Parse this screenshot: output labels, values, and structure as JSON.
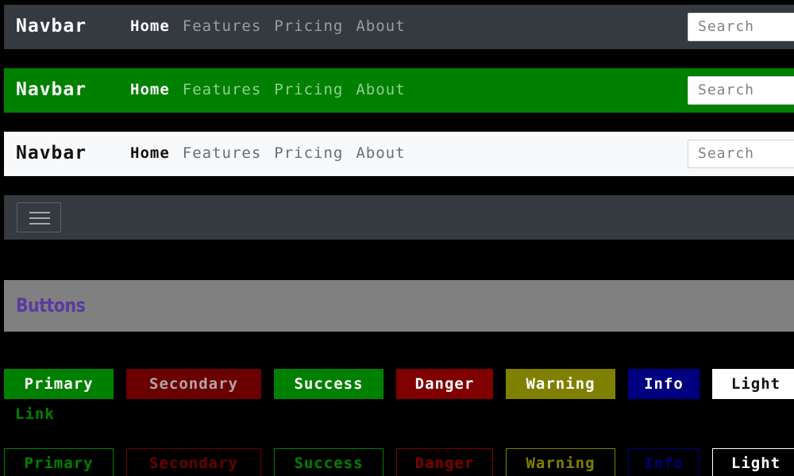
{
  "navbars": [
    {
      "variant": "dark",
      "brand": "Navbar",
      "links": [
        "Home",
        "Features",
        "Pricing",
        "About"
      ],
      "search_placeholder": "Search"
    },
    {
      "variant": "green",
      "brand": "Navbar",
      "links": [
        "Home",
        "Features",
        "Pricing",
        "About"
      ],
      "search_placeholder": "Search"
    },
    {
      "variant": "light",
      "brand": "Navbar",
      "links": [
        "Home",
        "Features",
        "Pricing",
        "About"
      ],
      "search_placeholder": "Search"
    },
    {
      "variant": "dark-collapsed",
      "toggler_icon": "hamburger-icon"
    }
  ],
  "sections": {
    "buttons_title": "Buttons"
  },
  "buttons": {
    "solid": [
      "Primary",
      "Secondary",
      "Success",
      "Danger",
      "Warning",
      "Info",
      "Light"
    ],
    "link": "Link",
    "outline": [
      "Primary",
      "Secondary",
      "Success",
      "Danger",
      "Warning",
      "Info",
      "Light"
    ]
  },
  "colors": {
    "dark_navbar": "#343a40",
    "green_navbar": "#008000",
    "light_navbar": "#f8f9fa",
    "section_header": "#808080",
    "section_title": "#5a3aa0",
    "primary": "#008000",
    "secondary": "#6b0000",
    "success": "#008000",
    "danger": "#800000",
    "warning": "#808000",
    "info": "#000080",
    "light": "#ffffff"
  }
}
